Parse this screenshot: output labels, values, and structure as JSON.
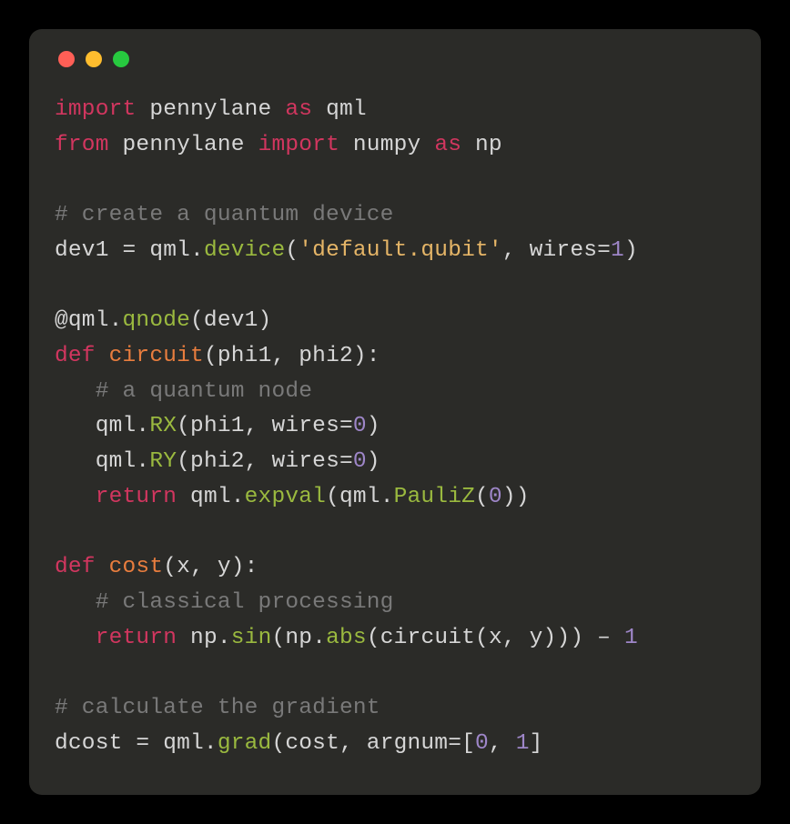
{
  "code": {
    "lines": [
      [
        {
          "cls": "kw",
          "t": "import"
        },
        {
          "cls": "txt",
          "t": " pennylane "
        },
        {
          "cls": "kw",
          "t": "as"
        },
        {
          "cls": "txt",
          "t": " qml"
        }
      ],
      [
        {
          "cls": "kw",
          "t": "from"
        },
        {
          "cls": "txt",
          "t": " pennylane "
        },
        {
          "cls": "kw",
          "t": "import"
        },
        {
          "cls": "txt",
          "t": " numpy "
        },
        {
          "cls": "kw",
          "t": "as"
        },
        {
          "cls": "txt",
          "t": " np"
        }
      ],
      [],
      [
        {
          "cls": "cmt",
          "t": "# create a quantum device"
        }
      ],
      [
        {
          "cls": "txt",
          "t": "dev1 = qml."
        },
        {
          "cls": "fn",
          "t": "device"
        },
        {
          "cls": "txt",
          "t": "("
        },
        {
          "cls": "str",
          "t": "'default.qubit'"
        },
        {
          "cls": "txt",
          "t": ", wires="
        },
        {
          "cls": "num",
          "t": "1"
        },
        {
          "cls": "txt",
          "t": ")"
        }
      ],
      [],
      [
        {
          "cls": "deco",
          "t": "@qml."
        },
        {
          "cls": "fn",
          "t": "qnode"
        },
        {
          "cls": "txt",
          "t": "(dev1)"
        }
      ],
      [
        {
          "cls": "kw",
          "t": "def"
        },
        {
          "cls": "txt",
          "t": " "
        },
        {
          "cls": "name",
          "t": "circuit"
        },
        {
          "cls": "txt",
          "t": "(phi1, phi2):"
        }
      ],
      [
        {
          "cls": "txt",
          "t": "   "
        },
        {
          "cls": "cmt",
          "t": "# a quantum node"
        }
      ],
      [
        {
          "cls": "txt",
          "t": "   qml."
        },
        {
          "cls": "fn",
          "t": "RX"
        },
        {
          "cls": "txt",
          "t": "(phi1, wires="
        },
        {
          "cls": "num",
          "t": "0"
        },
        {
          "cls": "txt",
          "t": ")"
        }
      ],
      [
        {
          "cls": "txt",
          "t": "   qml."
        },
        {
          "cls": "fn",
          "t": "RY"
        },
        {
          "cls": "txt",
          "t": "(phi2, wires="
        },
        {
          "cls": "num",
          "t": "0"
        },
        {
          "cls": "txt",
          "t": ")"
        }
      ],
      [
        {
          "cls": "txt",
          "t": "   "
        },
        {
          "cls": "kw",
          "t": "return"
        },
        {
          "cls": "txt",
          "t": " qml."
        },
        {
          "cls": "fn",
          "t": "expval"
        },
        {
          "cls": "txt",
          "t": "(qml."
        },
        {
          "cls": "fn",
          "t": "PauliZ"
        },
        {
          "cls": "txt",
          "t": "("
        },
        {
          "cls": "num",
          "t": "0"
        },
        {
          "cls": "txt",
          "t": "))"
        }
      ],
      [],
      [
        {
          "cls": "kw",
          "t": "def"
        },
        {
          "cls": "txt",
          "t": " "
        },
        {
          "cls": "name",
          "t": "cost"
        },
        {
          "cls": "txt",
          "t": "(x, y):"
        }
      ],
      [
        {
          "cls": "txt",
          "t": "   "
        },
        {
          "cls": "cmt",
          "t": "# classical processing"
        }
      ],
      [
        {
          "cls": "txt",
          "t": "   "
        },
        {
          "cls": "kw",
          "t": "return"
        },
        {
          "cls": "txt",
          "t": " np."
        },
        {
          "cls": "fn",
          "t": "sin"
        },
        {
          "cls": "txt",
          "t": "(np."
        },
        {
          "cls": "fn",
          "t": "abs"
        },
        {
          "cls": "txt",
          "t": "(circuit(x, y))) – "
        },
        {
          "cls": "num",
          "t": "1"
        }
      ],
      [],
      [
        {
          "cls": "cmt",
          "t": "# calculate the gradient"
        }
      ],
      [
        {
          "cls": "txt",
          "t": "dcost = qml."
        },
        {
          "cls": "fn",
          "t": "grad"
        },
        {
          "cls": "txt",
          "t": "(cost, argnum=["
        },
        {
          "cls": "num",
          "t": "0"
        },
        {
          "cls": "txt",
          "t": ", "
        },
        {
          "cls": "num",
          "t": "1"
        },
        {
          "cls": "txt",
          "t": "]"
        }
      ]
    ]
  },
  "traffic_lights": {
    "red": "close",
    "yellow": "minimize",
    "green": "zoom"
  }
}
